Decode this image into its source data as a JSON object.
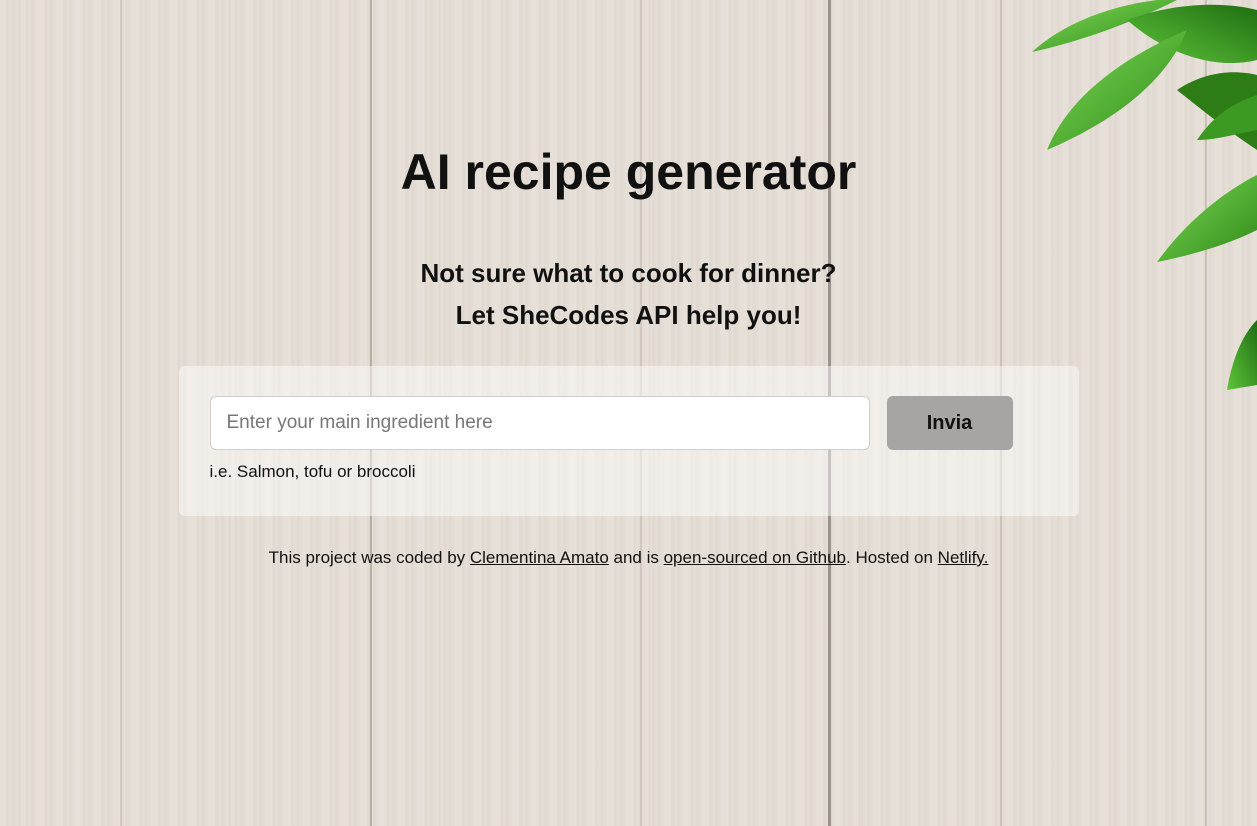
{
  "header": {
    "title": "AI recipe generator"
  },
  "subtitle": {
    "line1": "Not sure what to cook for dinner?",
    "line2": "Let SheCodes API help you!"
  },
  "form": {
    "input_placeholder": "Enter your main ingredient here",
    "input_value": "",
    "button_label": "Invia",
    "hint": "i.e. Salmon, tofu or broccoli"
  },
  "footer": {
    "text_1": "This project was coded by ",
    "author_link": "Clementina Amato",
    "text_2": " and is ",
    "github_link": "open-sourced on Github",
    "text_3": ". Hosted on ",
    "netlify_link": "Netlify."
  },
  "colors": {
    "button_bg": "#a9a4a4",
    "card_bg": "rgba(255,255,255,0.45)",
    "leaf_green": "#3aa51f",
    "wood": "#e4ddd5"
  },
  "icons": {
    "decoration": "leaves-decoration"
  }
}
